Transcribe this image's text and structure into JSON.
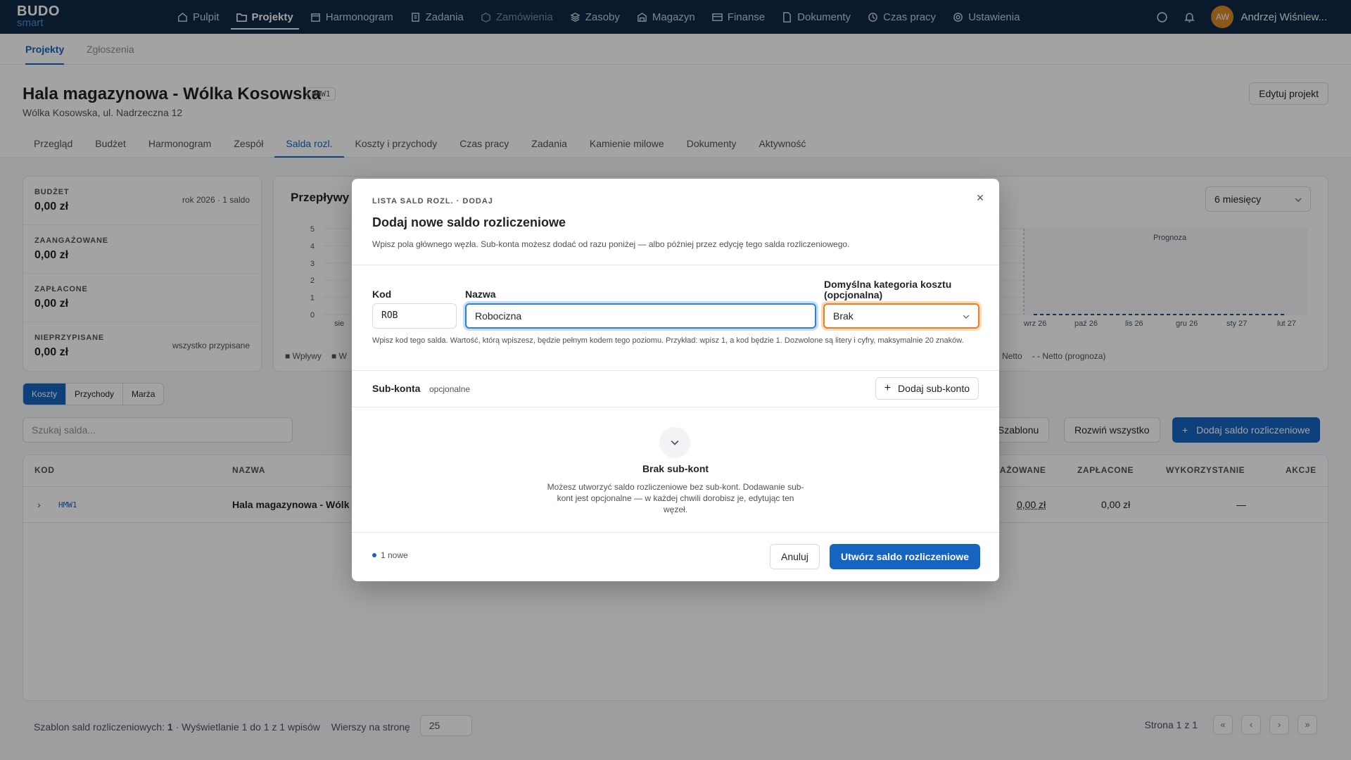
{
  "app": {
    "logo_top": "BUDO",
    "logo_bottom": "smart"
  },
  "nav": {
    "items": [
      {
        "label": "Pulpit",
        "icon": "home-icon"
      },
      {
        "label": "Projekty",
        "icon": "folder-icon"
      },
      {
        "label": "Harmonogram",
        "icon": "calendar-icon"
      },
      {
        "label": "Zadania",
        "icon": "clipboard-icon"
      },
      {
        "label": "Zamówienia",
        "icon": "box-icon"
      },
      {
        "label": "Zasoby",
        "icon": "layers-icon"
      },
      {
        "label": "Magazyn",
        "icon": "warehouse-icon"
      },
      {
        "label": "Finanse",
        "icon": "card-icon"
      },
      {
        "label": "Dokumenty",
        "icon": "document-icon"
      },
      {
        "label": "Czas pracy",
        "icon": "clock-icon"
      },
      {
        "label": "Ustawienia",
        "icon": "gear-icon"
      }
    ],
    "user_initials": "AW",
    "user_name": "Andrzej Wiśniew..."
  },
  "subtabs": [
    "Projekty",
    "Zgłoszenia"
  ],
  "project": {
    "title": "Hala magazynowa - Wólka Kosowska",
    "code": "HMW1",
    "address": "Wólka Kosowska, ul. Nadrzeczna 12",
    "edit_label": "Edytuj projekt",
    "tabs": [
      "Przegląd",
      "Budżet",
      "Harmonogram",
      "Zespół",
      "Salda rozl.",
      "Koszty i przychody",
      "Czas pracy",
      "Zadania",
      "Kamienie milowe",
      "Dokumenty",
      "Aktywność"
    ]
  },
  "stats": [
    {
      "label": "BUDŻET",
      "value": "0,00 zł",
      "side": "rok 2026 · 1 saldo"
    },
    {
      "label": "ZAANGAŻOWANE",
      "value": "0,00 zł",
      "side": ""
    },
    {
      "label": "ZAPŁACONE",
      "value": "0,00 zł",
      "side": ""
    },
    {
      "label": "NIEPRZYPISANE",
      "value": "0,00 zł",
      "side": "wszystko przypisane"
    }
  ],
  "chart": {
    "title": "Przepływy p",
    "period": "6 miesięcy",
    "forecast_label": "Prognoza",
    "y_ticks": [
      "5",
      "4",
      "3",
      "2",
      "1",
      "0"
    ],
    "x_ticks": [
      "sie",
      "wrz 26",
      "paź 26",
      "lis 26",
      "gru 26",
      "sty 27",
      "lut 27"
    ],
    "legend": [
      "Wpływy",
      "W",
      "Netto",
      "Netto (prognoza)"
    ]
  },
  "chart_data": {
    "type": "line",
    "title": "",
    "x": [
      "wrz 26",
      "paź 26",
      "lis 26",
      "gru 26",
      "sty 27",
      "lut 27"
    ],
    "series": [
      {
        "name": "Netto (prognoza)",
        "values": [
          0,
          0,
          0,
          0,
          0,
          0
        ]
      }
    ],
    "ylim": [
      0,
      5
    ]
  },
  "filters": {
    "segments": [
      "Koszty",
      "Przychody",
      "Marża"
    ],
    "search_placeholder": "Szukaj salda...",
    "template_btn": "z Szablonu",
    "expand_btn": "Rozwiń wszystko",
    "add_btn": "Dodaj saldo rozliczeniowe"
  },
  "table": {
    "headers": [
      "KOD",
      "NAZWA",
      "GAŻOWANE",
      "ZAPŁACONE",
      "WYKORZYSTANIE",
      "AKCJE"
    ],
    "row": {
      "code": "HMW1",
      "name": "Hala magazynowa - Wólk",
      "committed": "0,00 zł",
      "paid": "0,00 zł",
      "usage": "—"
    }
  },
  "footer": {
    "summary_prefix": "Szablon sald rozliczeniowych:",
    "summary_count": "1",
    "showing": "Wyświetlanie 1 do 1 z 1 wpisów",
    "rows_label": "Wierszy na stronę",
    "rows_value": "25",
    "page": "Strona 1 z 1"
  },
  "modal": {
    "crumb": "LISTA SALD ROZL. · DODAJ",
    "title": "Dodaj nowe saldo rozliczeniowe",
    "description": "Wpisz pola głównego węzła. Sub-konta możesz dodać od razu poniżej — albo później przez edycję tego salda rozliczeniowego.",
    "code_label": "Kod",
    "code_value": "ROB",
    "name_label": "Nazwa",
    "name_value": "Robocizna",
    "category_label": "Domyślna kategoria kosztu (opcjonalna)",
    "category_value": "Brak",
    "help": "Wpisz kod tego salda. Wartość, którą wpiszesz, będzie pełnym kodem tego poziomu. Przykład: wpisz 1, a kod będzie 1. Dozwolone są litery i cyfry, maksymalnie 20 znaków.",
    "sub_title": "Sub-konta",
    "sub_optional": "opcjonalne",
    "add_sub": "Dodaj sub-konto",
    "empty_title": "Brak sub-kont",
    "empty_desc": "Możesz utworzyć saldo rozliczeniowe bez sub-kont. Dodawanie sub-kont jest opcjonalne — w każdej chwili dorobisz je, edytując ten węzeł.",
    "new_count": "1 nowe",
    "cancel": "Anuluj",
    "create": "Utwórz saldo rozliczeniowe"
  }
}
